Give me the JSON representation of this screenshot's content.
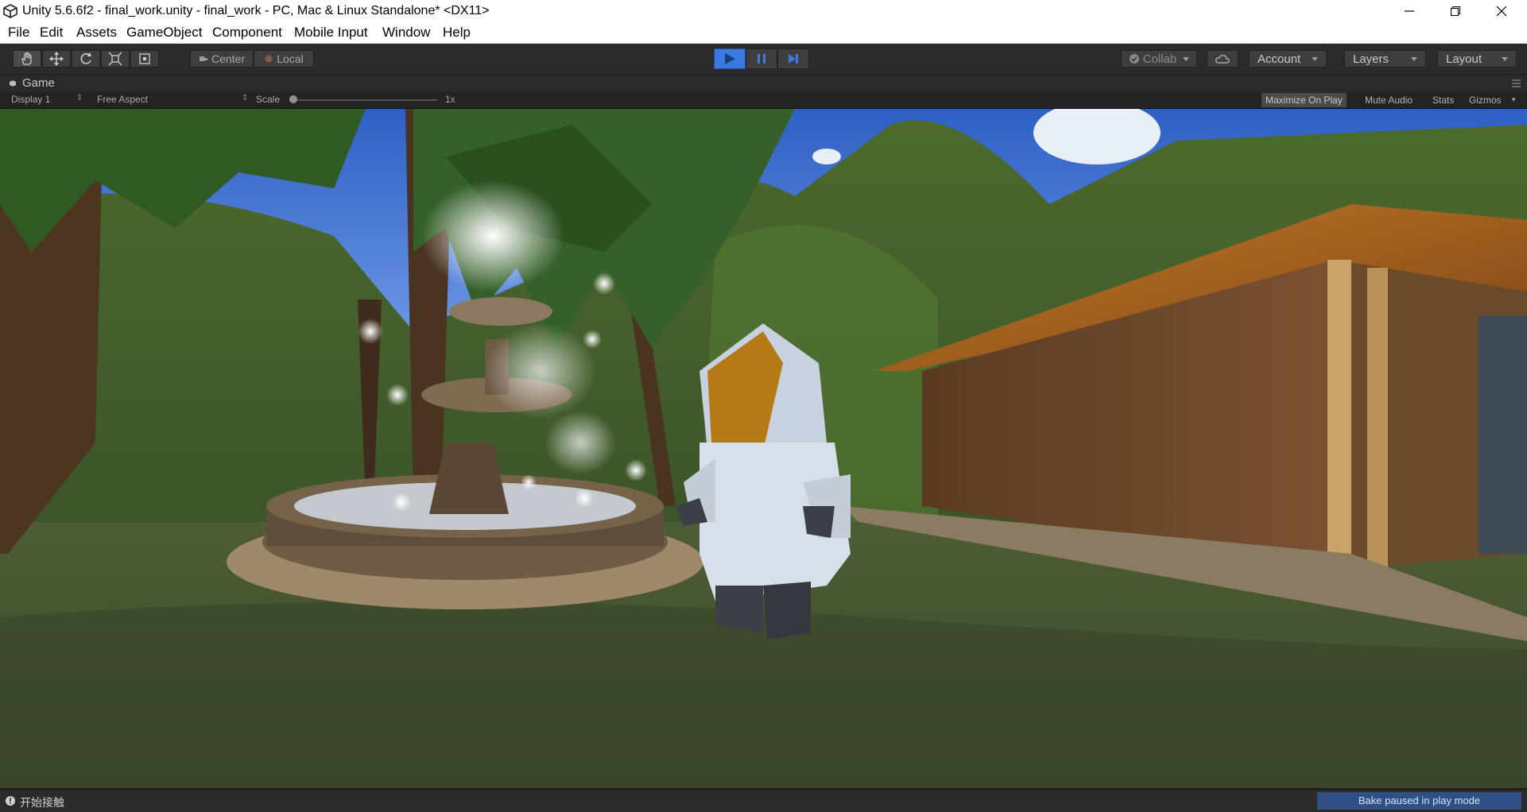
{
  "window": {
    "title": "Unity 5.6.6f2 - final_work.unity - final_work - PC, Mac & Linux Standalone* <DX11>",
    "icon": "unity-logo-icon",
    "controls": [
      "minimize-icon",
      "restore-icon",
      "close-icon"
    ]
  },
  "menu": {
    "items": [
      "File",
      "Edit",
      "Assets",
      "GameObject",
      "Component",
      "Mobile Input",
      "Window",
      "Help"
    ]
  },
  "toolbar": {
    "tools": [
      "hand-icon",
      "move-icon",
      "rotate-icon",
      "scale-icon",
      "rect-icon"
    ],
    "pivot_label": "Center",
    "rotation_label": "Local",
    "play_controls": [
      "play-icon",
      "pause-icon",
      "step-icon"
    ],
    "play_state": "playing",
    "collab_label": "Collab",
    "account_label": "Account",
    "layers_label": "Layers",
    "layout_label": "Layout"
  },
  "game_view": {
    "tab_label": "Game",
    "display_label": "Display 1",
    "aspect_label": "Free Aspect",
    "scale_label": "Scale",
    "scale_value": "1x",
    "maximize_label": "Maximize On Play",
    "mute_label": "Mute Audio",
    "stats_label": "Stats",
    "gizmos_label": "Gizmos",
    "maximize_active": true
  },
  "status": {
    "message": "开始接触",
    "bake_status": "Bake paused in play mode"
  },
  "colors": {
    "toolbar_bg": "#2b2b2b",
    "play_active": "#3b78e0",
    "bake_badge": "#2f4f86"
  }
}
